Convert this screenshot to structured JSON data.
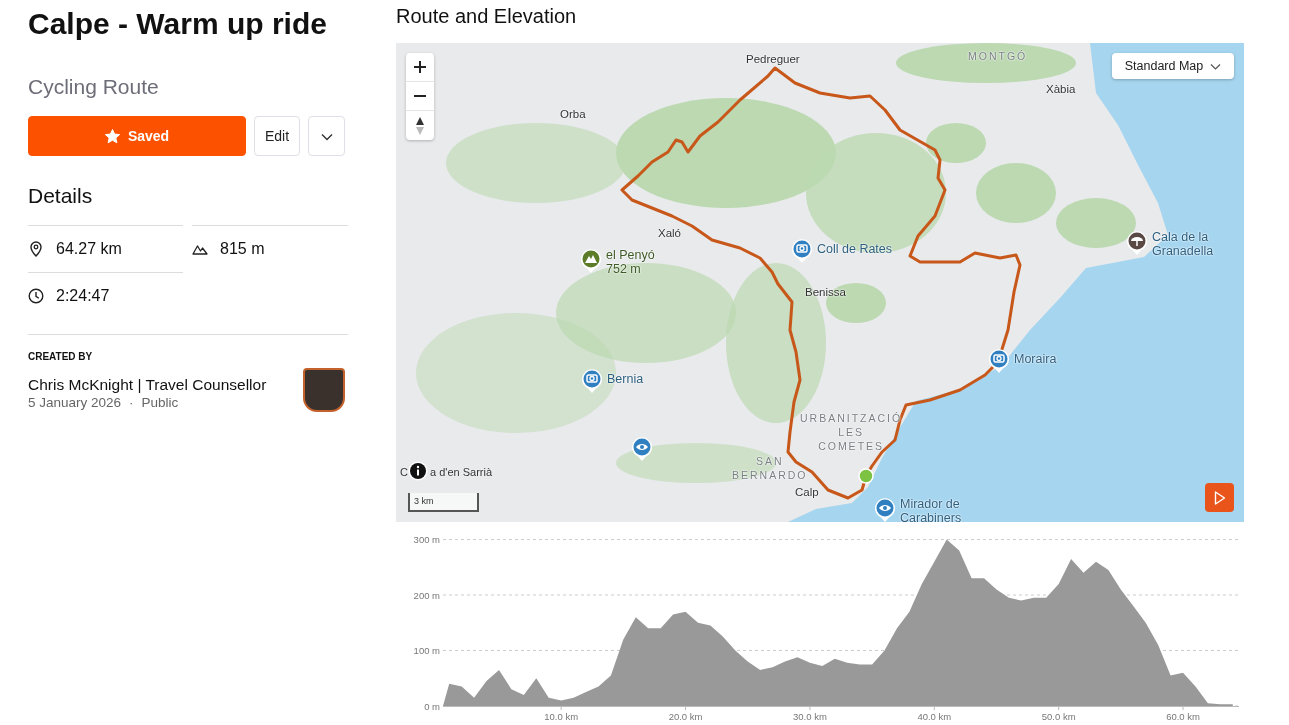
{
  "page": {
    "title": "Calpe - Warm up ride",
    "subtitle": "Cycling Route"
  },
  "actions": {
    "save": {
      "label": "Saved",
      "selected": true
    },
    "edit": {
      "label": "Edit"
    }
  },
  "details": {
    "heading": "Details",
    "stats": [
      {
        "kind": "distance",
        "value": "64.27 km"
      },
      {
        "kind": "elevation",
        "value": "815 m"
      },
      {
        "kind": "duration",
        "value": "2:24:47"
      }
    ]
  },
  "creator": {
    "label": "CREATED BY",
    "name": "Chris McKnight | Travel Counsellor",
    "date": "5 January 2026",
    "separator": "·",
    "visibility": "Public"
  },
  "route": {
    "title": "Route and Elevation",
    "map": {
      "layer_select": "Standard Map",
      "scale": "3 km",
      "attribution": {
        "before": "C",
        "after": "a d'en Sarrià"
      },
      "labels": [
        {
          "kind": "place",
          "lines": [
            "Pedreguer"
          ]
        },
        {
          "kind": "place",
          "lines": [
            "Orba"
          ]
        },
        {
          "kind": "area",
          "lines": [
            "MONTGÓ"
          ]
        },
        {
          "kind": "place",
          "lines": [
            "Xàbia"
          ]
        },
        {
          "kind": "place",
          "lines": [
            "Xaló"
          ]
        },
        {
          "kind": "mountain",
          "lines": [
            "el Penyó",
            "752 m"
          ]
        },
        {
          "kind": "camera",
          "lines": [
            "Coll de Rates"
          ]
        },
        {
          "kind": "beach",
          "lines": [
            "Cala de la",
            "Granadella"
          ]
        },
        {
          "kind": "place",
          "lines": [
            "Benissa"
          ]
        },
        {
          "kind": "camera",
          "lines": [
            "Moraira"
          ]
        },
        {
          "kind": "camera",
          "lines": [
            "Bernia"
          ]
        },
        {
          "kind": "viewpoint"
        },
        {
          "kind": "area",
          "lines": [
            "URBANITZACIÓ",
            "LES",
            "COMETES"
          ]
        },
        {
          "kind": "area",
          "lines": [
            "SAN",
            "BERNARDO"
          ]
        },
        {
          "kind": "place",
          "lines": [
            "Calp"
          ]
        },
        {
          "kind": "viewpoint",
          "lines": [
            "Mirador de",
            "Carabiners"
          ]
        }
      ]
    },
    "elevation": {
      "chart_data": {
        "type": "area",
        "x": [
          0.5,
          1,
          2,
          3,
          4,
          5,
          6,
          7,
          8,
          9,
          10,
          11,
          12,
          13,
          14,
          15,
          16,
          17,
          18,
          19,
          20,
          21,
          22,
          23,
          24,
          25,
          26,
          27,
          28,
          29,
          30,
          31,
          32,
          33,
          34,
          35,
          36,
          37,
          38,
          39,
          40,
          41,
          42,
          43,
          44,
          45,
          46,
          47,
          48,
          49,
          50,
          51,
          52,
          53,
          54,
          55,
          56,
          57,
          58,
          59,
          60,
          61,
          62,
          63,
          64
        ],
        "series": [
          {
            "color": "#999999",
            "values": [
              0,
              40,
              35,
              15,
              45,
              65,
              30,
              20,
              50,
              15,
              10,
              15,
              25,
              35,
              55,
              120,
              160,
              140,
              140,
              165,
              170,
              150,
              145,
              125,
              100,
              80,
              65,
              70,
              80,
              88,
              78,
              72,
              85,
              78,
              75,
              75,
              100,
              140,
              170,
              220,
              260,
              300,
              280,
              230,
              230,
              210,
              195,
              190,
              195,
              195,
              220,
              265,
              240,
              260,
              245,
              210,
              180,
              150,
              110,
              55,
              60,
              35,
              5,
              3,
              3
            ]
          }
        ],
        "xlim": [
          0.5,
          64.5
        ],
        "ylim": [
          0,
          300
        ],
        "xticks": [
          {
            "value": 10,
            "label": "10.0 km"
          },
          {
            "value": 20,
            "label": "20.0 km"
          },
          {
            "value": 30,
            "label": "30.0 km"
          },
          {
            "value": 40,
            "label": "40.0 km"
          },
          {
            "value": 50,
            "label": "50.0 km"
          },
          {
            "value": 60,
            "label": "60.0 km"
          }
        ],
        "yticks": [
          {
            "value": 0,
            "label": "0 m"
          },
          {
            "value": 100,
            "label": "100 m"
          },
          {
            "value": 200,
            "label": "200 m"
          },
          {
            "value": 300,
            "label": "300 m"
          }
        ]
      }
    }
  }
}
